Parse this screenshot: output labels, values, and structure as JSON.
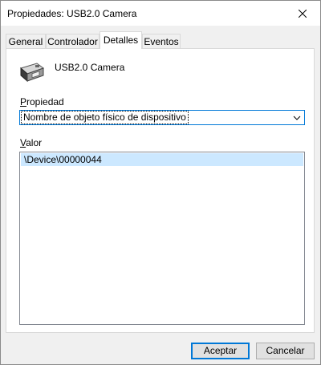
{
  "window": {
    "title": "Propiedades: USB2.0 Camera",
    "close_icon": "close-icon"
  },
  "tabs": [
    {
      "label": "General",
      "active": false
    },
    {
      "label": "Controlador",
      "active": false
    },
    {
      "label": "Detalles",
      "active": true
    },
    {
      "label": "Eventos",
      "active": false
    }
  ],
  "device": {
    "icon": "camera-device-icon",
    "name": "USB2.0 Camera"
  },
  "property": {
    "label_underlined": "P",
    "label_rest": "ropiedad",
    "selected": "Nombre de objeto físico de dispositivo",
    "dropdown_icon": "chevron-down-icon"
  },
  "value": {
    "label_underlined": "V",
    "label_rest": "alor",
    "items": [
      "\\Device\\00000044"
    ],
    "selected_index": 0,
    "selection_color": "#cce8ff"
  },
  "buttons": {
    "ok_label": "Aceptar",
    "cancel_label": "Cancelar"
  },
  "colors": {
    "accent": "#0078d7",
    "window_bg": "#f0f0f0",
    "panel_bg": "#ffffff"
  }
}
